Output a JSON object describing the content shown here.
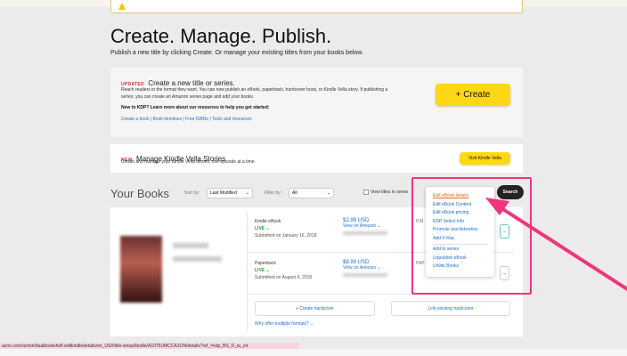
{
  "header": {
    "title": "Create. Manage. Publish.",
    "subtitle": "Publish a new title by clicking Create. Or manage your existing titles from your books below."
  },
  "create_card": {
    "tag": "UPDATED",
    "heading": "Create a new title or series.",
    "body": "Reach readers in the format they want. You can now publish an eBook, paperback, hardcover book, or Kindle Vella story. If publishing a series, you can create an Amazon series page and add your books.",
    "new_to_kdp": "New to KDP? Learn more about our resources to help you get started:",
    "links": [
      "Create a book",
      "Book timelines",
      "Free ISBNs",
      "Tools and resources"
    ],
    "create_label": "+ Create"
  },
  "vella_card": {
    "tag": "NEW",
    "heading": "Manage Kindle Vella Stories",
    "body": "Create and manage your Kindle Vella stories, one episode at a time.",
    "button": "Visit Kindle Vella"
  },
  "your_books": {
    "title": "Your Books",
    "sort_label": "Sort by:",
    "sort_value": "Last Modified",
    "filter_label": "Filter by:",
    "filter_value": "All",
    "series_checkbox": "View titles in series",
    "search_button": "Search"
  },
  "formats": [
    {
      "type": "Kindle eBook",
      "status": "LIVE",
      "submitted": "Submitted on January 16, 2018",
      "price": "$2.99 USD",
      "view": "View on Amazon",
      "side_label": "KIN"
    },
    {
      "type": "Paperback",
      "status": "LIVE",
      "submitted": "Submitted on August 9, 2018",
      "price": "$8.99 USD",
      "view": "View on Amazon",
      "side_label": "PAP"
    }
  ],
  "menu": {
    "items": [
      "Edit eBook details",
      "Edit eBook Content",
      "Edit eBook pricing",
      "KDP Select Info",
      "Promote and Advertise",
      "Add X-Ray"
    ],
    "items2": [
      "Add to series",
      "Unpublish eBook",
      "Unlink Books"
    ]
  },
  "actions": {
    "create_hardcover": "+ Create hardcover",
    "link_hardcover": "Link existing hardcover",
    "why": "Why offer multiple formats?",
    "more": "..."
  },
  "status_bar": "azon.com/action/dualbookshelf.editkindledetails/en_US#/title-setup/kindle/A1075UMCCA1ON/details?ref_=kdp_BS_D_ta_ed",
  "colors": {
    "accent_yellow": "#ffd814",
    "link": "#1a6fc9",
    "highlight": "#f0357c",
    "live": "#2e9e3e",
    "menu_active": "#e06a1b"
  }
}
